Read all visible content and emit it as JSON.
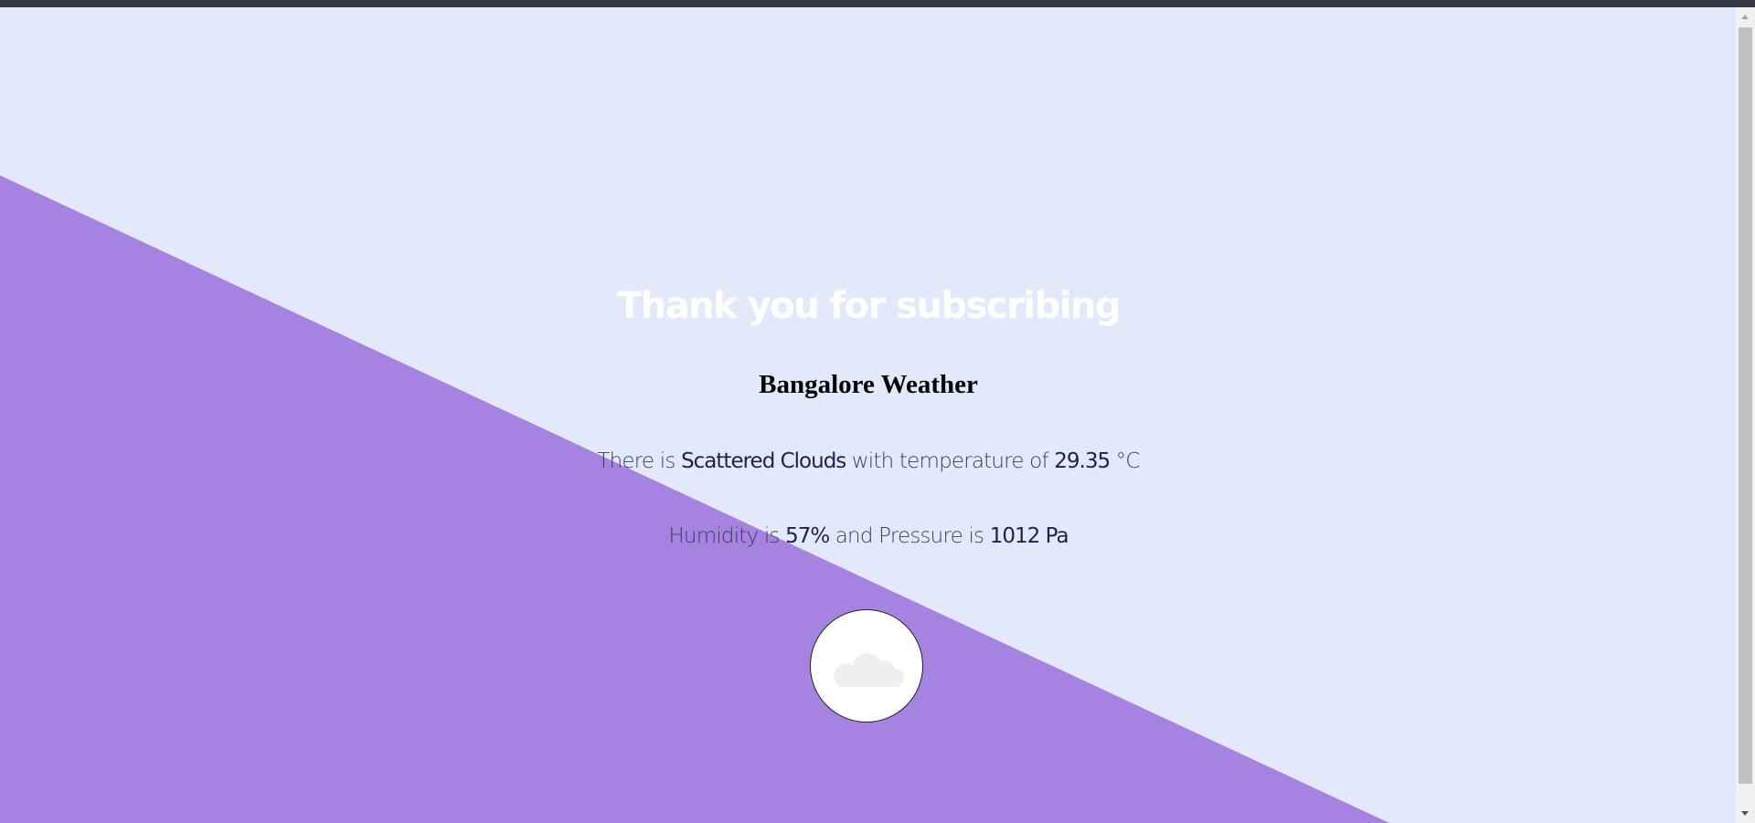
{
  "page": {
    "title": "Thank you for subscribing",
    "city_heading": "Bangalore Weather"
  },
  "weather": {
    "line1_prefix": "There is",
    "description": "Scattered Clouds",
    "line1_middle": "with temperature of",
    "temperature": "29.35",
    "temperature_unit": "°C",
    "line2_prefix": "Humidity is",
    "humidity": "57%",
    "line2_middle": "and Pressure is",
    "pressure": "1012 Pa",
    "icon": "cloud-icon"
  },
  "colors": {
    "background_light": "#e3e8fb",
    "background_purple": "#a683e1",
    "title_text": "#ffffff",
    "accent_text": "#1c2250"
  }
}
